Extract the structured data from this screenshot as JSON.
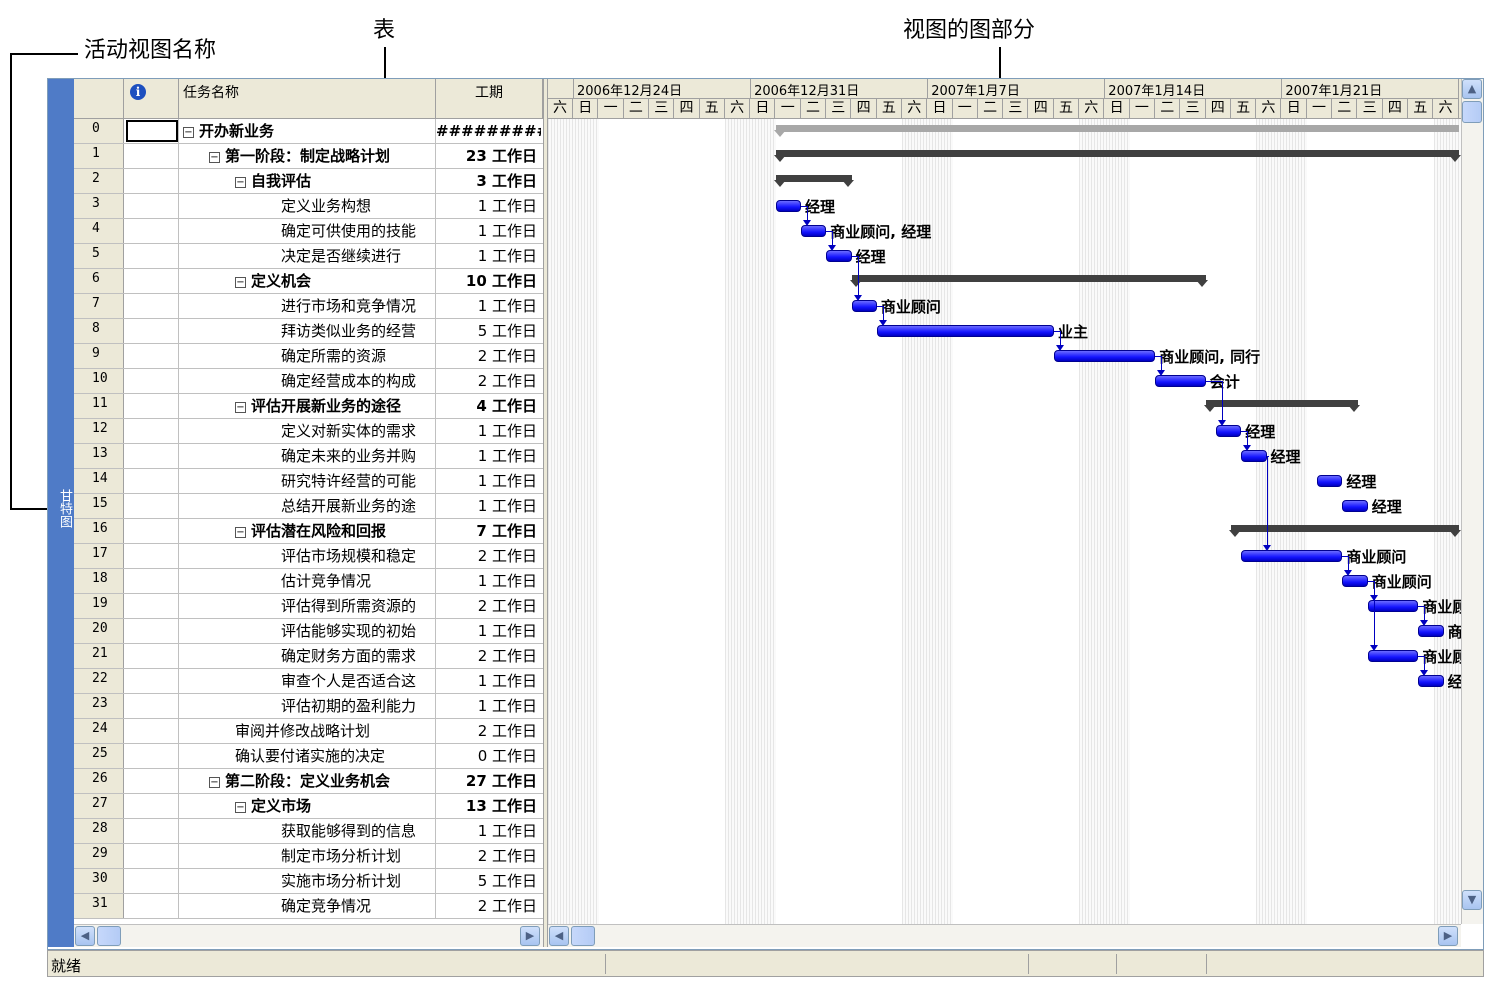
{
  "annotations": {
    "active_view_name": "活动视图名称",
    "table": "表",
    "chart_part": "视图的图部分"
  },
  "view_bar": {
    "label": "甘特图"
  },
  "table": {
    "headers": {
      "id": "",
      "indicator": "i",
      "name": "任务名称",
      "duration": "工期"
    },
    "rows": [
      {
        "id": "0",
        "name": "开办新业务",
        "duration": "#########",
        "level": 0,
        "summary": true
      },
      {
        "id": "1",
        "name": "第一阶段：制定战略计划",
        "duration": "23 工作日",
        "level": 1,
        "summary": true
      },
      {
        "id": "2",
        "name": "自我评估",
        "duration": "3 工作日",
        "level": 2,
        "summary": true
      },
      {
        "id": "3",
        "name": "定义业务构想",
        "duration": "1 工作日",
        "level": 3,
        "summary": false
      },
      {
        "id": "4",
        "name": "确定可供使用的技能",
        "duration": "1 工作日",
        "level": 3,
        "summary": false
      },
      {
        "id": "5",
        "name": "决定是否继续进行",
        "duration": "1 工作日",
        "level": 3,
        "summary": false
      },
      {
        "id": "6",
        "name": "定义机会",
        "duration": "10 工作日",
        "level": 2,
        "summary": true
      },
      {
        "id": "7",
        "name": "进行市场和竞争情况",
        "duration": "1 工作日",
        "level": 3,
        "summary": false
      },
      {
        "id": "8",
        "name": "拜访类似业务的经营",
        "duration": "5 工作日",
        "level": 3,
        "summary": false
      },
      {
        "id": "9",
        "name": "确定所需的资源",
        "duration": "2 工作日",
        "level": 3,
        "summary": false
      },
      {
        "id": "10",
        "name": "确定经营成本的构成",
        "duration": "2 工作日",
        "level": 3,
        "summary": false
      },
      {
        "id": "11",
        "name": "评估开展新业务的途径",
        "duration": "4 工作日",
        "level": 2,
        "summary": true
      },
      {
        "id": "12",
        "name": "定义对新实体的需求",
        "duration": "1 工作日",
        "level": 3,
        "summary": false
      },
      {
        "id": "13",
        "name": "确定未来的业务并购",
        "duration": "1 工作日",
        "level": 3,
        "summary": false
      },
      {
        "id": "14",
        "name": "研究特许经营的可能",
        "duration": "1 工作日",
        "level": 3,
        "summary": false
      },
      {
        "id": "15",
        "name": "总结开展新业务的途",
        "duration": "1 工作日",
        "level": 3,
        "summary": false
      },
      {
        "id": "16",
        "name": "评估潜在风险和回报",
        "duration": "7 工作日",
        "level": 2,
        "summary": true
      },
      {
        "id": "17",
        "name": "评估市场规模和稳定",
        "duration": "2 工作日",
        "level": 3,
        "summary": false
      },
      {
        "id": "18",
        "name": "估计竞争情况",
        "duration": "1 工作日",
        "level": 3,
        "summary": false
      },
      {
        "id": "19",
        "name": "评估得到所需资源的",
        "duration": "2 工作日",
        "level": 3,
        "summary": false
      },
      {
        "id": "20",
        "name": "评估能够实现的初始",
        "duration": "1 工作日",
        "level": 3,
        "summary": false
      },
      {
        "id": "21",
        "name": "确定财务方面的需求",
        "duration": "2 工作日",
        "level": 3,
        "summary": false
      },
      {
        "id": "22",
        "name": "审查个人是否适合这",
        "duration": "1 工作日",
        "level": 3,
        "summary": false
      },
      {
        "id": "23",
        "name": "评估初期的盈利能力",
        "duration": "1 工作日",
        "level": 3,
        "summary": false
      },
      {
        "id": "24",
        "name": "审阅并修改战略计划",
        "duration": "2 工作日",
        "level": 2,
        "summary": false
      },
      {
        "id": "25",
        "name": "确认要付诸实施的决定",
        "duration": "0 工作日",
        "level": 2,
        "summary": false
      },
      {
        "id": "26",
        "name": "第二阶段：定义业务机会",
        "duration": "27 工作日",
        "level": 1,
        "summary": true
      },
      {
        "id": "27",
        "name": "定义市场",
        "duration": "13 工作日",
        "level": 2,
        "summary": true
      },
      {
        "id": "28",
        "name": "获取能够得到的信息",
        "duration": "1 工作日",
        "level": 3,
        "summary": false
      },
      {
        "id": "29",
        "name": "制定市场分析计划",
        "duration": "2 工作日",
        "level": 3,
        "summary": false
      },
      {
        "id": "30",
        "name": "实施市场分析计划",
        "duration": "5 工作日",
        "level": 3,
        "summary": false
      },
      {
        "id": "31",
        "name": "确定竞争情况",
        "duration": "2 工作日",
        "level": 3,
        "summary": false
      }
    ]
  },
  "timescale": {
    "weeks": [
      "2006年12月24日",
      "2006年12月31日",
      "2007年1月7日",
      "2007年1月14日",
      "2007年1月21日"
    ],
    "days": [
      "六",
      "日",
      "一",
      "二",
      "三",
      "四",
      "五"
    ]
  },
  "gantt": {
    "summaries": [
      {
        "row": 0,
        "start": 9,
        "end": 36,
        "type": "project"
      },
      {
        "row": 1,
        "start": 9,
        "end": 36
      },
      {
        "row": 2,
        "start": 9,
        "end": 12
      },
      {
        "row": 6,
        "start": 12,
        "end": 26
      },
      {
        "row": 11,
        "start": 26,
        "end": 32
      },
      {
        "row": 16,
        "start": 27,
        "end": 36
      }
    ],
    "tasks": [
      {
        "row": 3,
        "start": 9,
        "end": 10,
        "resource": "经理"
      },
      {
        "row": 4,
        "start": 10,
        "end": 11,
        "resource": "商业顾问, 经理"
      },
      {
        "row": 5,
        "start": 11,
        "end": 12,
        "resource": "经理"
      },
      {
        "row": 7,
        "start": 12,
        "end": 13,
        "resource": "商业顾问"
      },
      {
        "row": 8,
        "start": 13,
        "end": 20,
        "resource": "业主"
      },
      {
        "row": 9,
        "start": 20,
        "end": 24,
        "resource": "商业顾问, 同行"
      },
      {
        "row": 10,
        "start": 24,
        "end": 26,
        "resource": "会计"
      },
      {
        "row": 12,
        "start": 26.4,
        "end": 27.4,
        "resource": "经理"
      },
      {
        "row": 13,
        "start": 27.4,
        "end": 28.4,
        "resource": "经理"
      },
      {
        "row": 14,
        "start": 30.4,
        "end": 31.4,
        "resource": "经理"
      },
      {
        "row": 15,
        "start": 31.4,
        "end": 32.4,
        "resource": "经理"
      },
      {
        "row": 17,
        "start": 27.4,
        "end": 31.4,
        "resource": "商业顾问"
      },
      {
        "row": 18,
        "start": 31.4,
        "end": 32.4,
        "resource": "商业顾问"
      },
      {
        "row": 19,
        "start": 32.4,
        "end": 34.4,
        "resource": "商业顾"
      },
      {
        "row": 20,
        "start": 34.4,
        "end": 35.4,
        "resource": "商"
      },
      {
        "row": 21,
        "start": 32.4,
        "end": 34.4,
        "resource": "商业顾"
      },
      {
        "row": 22,
        "start": 34.4,
        "end": 35.4,
        "resource": "经"
      }
    ]
  },
  "status": {
    "text": "就绪"
  }
}
